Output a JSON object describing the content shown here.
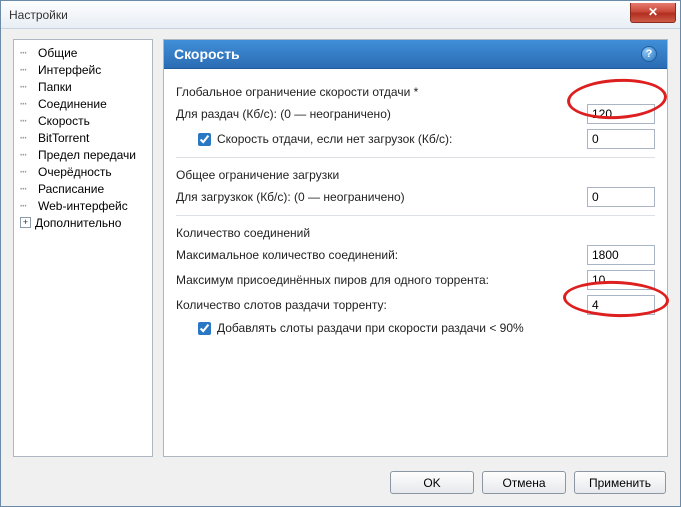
{
  "window": {
    "title": "Настройки"
  },
  "sidebar": {
    "items": [
      "Общие",
      "Интерфейс",
      "Папки",
      "Соединение",
      "Скорость",
      "BitTorrent",
      "Предел передачи",
      "Очерёдность",
      "Расписание",
      "Web-интерфейс"
    ],
    "extra": "Дополнительно"
  },
  "section": {
    "title": "Скорость",
    "upload": {
      "group": "Глобальное ограничение скорости отдачи *",
      "label": "Для раздач (Кб/с): (0 — неограничено)",
      "value": "120",
      "alt_check_label": "Скорость отдачи, если нет загрузок (Кб/с):",
      "alt_value": "0"
    },
    "download": {
      "group": "Общее ограничение загрузки",
      "label": "Для загрузкок (Кб/с): (0 — неограничено)",
      "value": "0"
    },
    "conn": {
      "group": "Количество соединений",
      "max_conn_label": "Максимальное количество соединений:",
      "max_conn_value": "1800",
      "max_peers_label": "Максимум присоединённых пиров для одного торрента:",
      "max_peers_value": "10",
      "slots_label": "Количество слотов раздачи торренту:",
      "slots_value": "4",
      "add_slots_label": "Добавлять слоты раздачи при скорости раздачи < 90%"
    }
  },
  "buttons": {
    "ok": "OK",
    "cancel": "Отмена",
    "apply": "Применить"
  }
}
